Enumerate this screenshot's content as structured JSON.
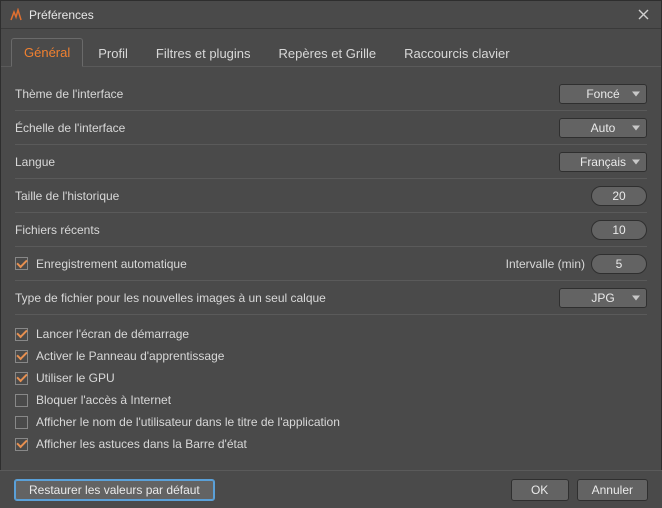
{
  "window": {
    "title": "Préférences"
  },
  "tabs": [
    {
      "label": "Général",
      "active": true
    },
    {
      "label": "Profil",
      "active": false
    },
    {
      "label": "Filtres et plugins",
      "active": false
    },
    {
      "label": "Repères et Grille",
      "active": false
    },
    {
      "label": "Raccourcis clavier",
      "active": false
    }
  ],
  "settings": {
    "theme_label": "Thème de l'interface",
    "theme_value": "Foncé",
    "scale_label": "Échelle de l'interface",
    "scale_value": "Auto",
    "language_label": "Langue",
    "language_value": "Français",
    "history_label": "Taille de l'historique",
    "history_value": "20",
    "recent_label": "Fichiers récents",
    "recent_value": "10",
    "autosave_label": "Enregistrement automatique",
    "autosave_checked": true,
    "interval_label": "Intervalle (min)",
    "interval_value": "5",
    "newfile_label": "Type de fichier pour les nouvelles images à un seul calque",
    "newfile_value": "JPG"
  },
  "checks": [
    {
      "label": "Lancer l'écran de démarrage",
      "checked": true
    },
    {
      "label": "Activer le Panneau d'apprentissage",
      "checked": true
    },
    {
      "label": "Utiliser le GPU",
      "checked": true
    },
    {
      "label": "Bloquer l'accès à Internet",
      "checked": false
    },
    {
      "label": "Afficher le nom de l'utilisateur dans le titre de l'application",
      "checked": false
    },
    {
      "label": "Afficher les astuces dans la Barre d'état",
      "checked": true
    }
  ],
  "footer": {
    "restore": "Restaurer les valeurs par défaut",
    "ok": "OK",
    "cancel": "Annuler"
  }
}
